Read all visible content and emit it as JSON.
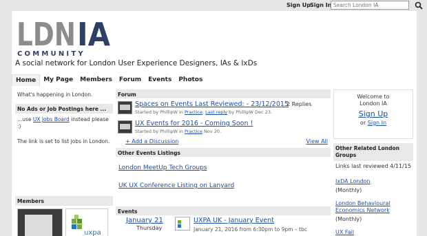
{
  "topbar": {
    "signup": "Sign Up",
    "signin": "Sign In",
    "search_placeholder": "Search London IA"
  },
  "brand": {
    "logo_top": "LDNIA",
    "logo_bottom": "COMMUNITY",
    "tagline": "A social network for London User Experience Designers, IAs & IxDs"
  },
  "nav": [
    "Home",
    "My Page",
    "Members",
    "Forum",
    "Events",
    "Photos"
  ],
  "left": {
    "happening": "What's happening in London.",
    "noads_title": "No Ads or Job Postings here ...",
    "noads_pre": "...use",
    "noads_link": "UX Jobs Board",
    "noads_post": "instead please :)",
    "noads_note": "The link is set to list jobs in London.",
    "members_title": "Members",
    "member2_logo_text": "uxpa"
  },
  "forum": {
    "title": "Forum",
    "discussions": [
      {
        "title": "Spaces on Events Last Reviewed: - 23/12/2015",
        "meta_prefix": "Started by PhillipW in",
        "category": "Practice",
        "meta_mid": ".",
        "last": "Last reply",
        "meta_suffix": "by PhillipW Dec 23.",
        "replies": "2 Replies"
      },
      {
        "title": "UX Events for 2016 - Coming Soon !",
        "meta_prefix": "Started by PhillipW in",
        "category": "Practice",
        "meta_mid": "Nov 20.",
        "last": "",
        "meta_suffix": "",
        "replies": ""
      }
    ],
    "add": "+ Add a Discussion",
    "view_all": "View All"
  },
  "other_events": {
    "title": "Other Events Listings",
    "links": [
      "London MeetUp Tech Groups",
      "UK UX Conference Listing on Lanyard"
    ]
  },
  "events": {
    "title": "Events",
    "date": "January 21",
    "day": "Thursday",
    "event_title": "UXPA UK - January Event",
    "event_meta": "January 21, 2016 from 6:30pm to 9pm – tbc"
  },
  "welcome": {
    "line1": "Welcome to",
    "line2": "London IA",
    "signup": "Sign Up",
    "or": "or",
    "signin": "Sign In"
  },
  "groups": {
    "title": "Other Related London Groups",
    "reviewed": "Links last reviewed 4/11/15",
    "items": [
      {
        "name": "IxDA London",
        "freq": "(Monthly)"
      },
      {
        "name": "London Behavioural Economics Network",
        "freq": "(Monthly)"
      },
      {
        "name": "UX Fail",
        "freq": ""
      }
    ]
  },
  "colors": {
    "link": "#1a4fa8",
    "logo_navy": "#2d3f63",
    "logo_gray": "#8c8c8c",
    "uxpa_green": "#7aa842",
    "uxpa_blue": "#2e74b5"
  }
}
